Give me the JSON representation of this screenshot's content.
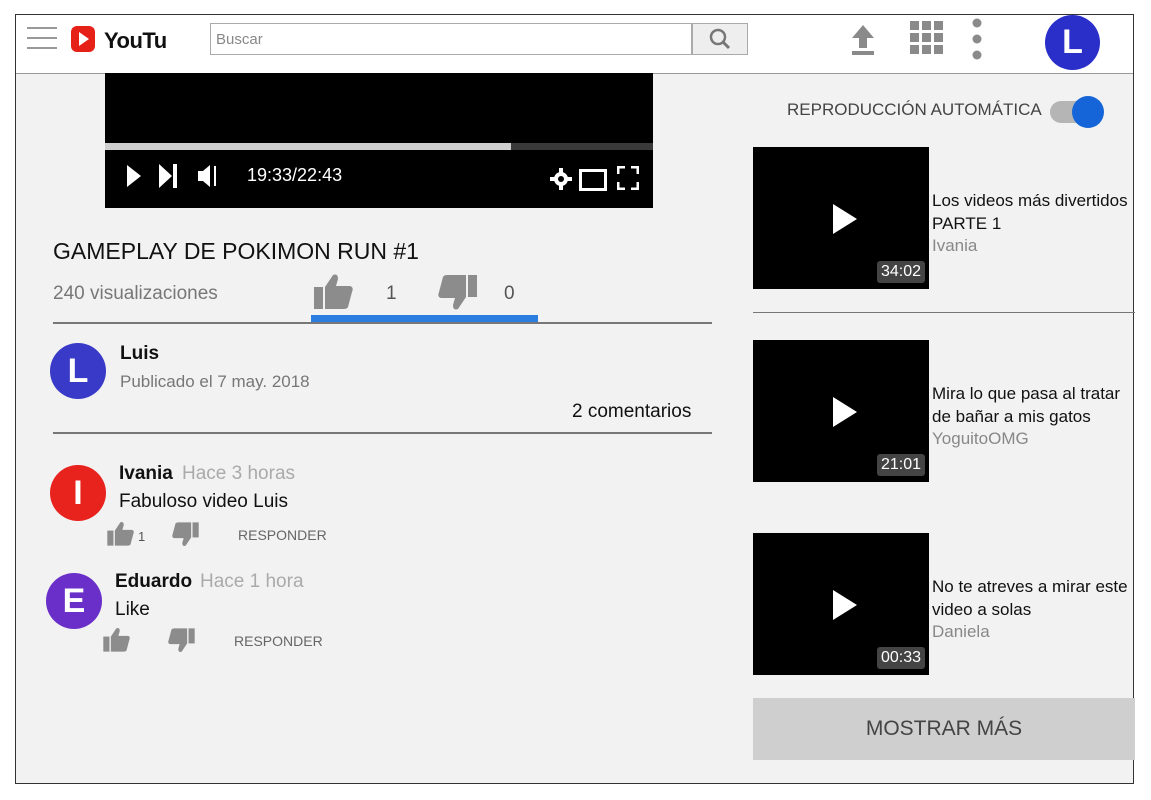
{
  "header": {
    "logo_text": "YouTu",
    "search_placeholder": "Buscar",
    "avatar_letter": "L",
    "colors": {
      "logo": "#e62117",
      "avatar": "#2a2fc9"
    }
  },
  "player": {
    "time": "19:33/22:43",
    "progress": 0.74
  },
  "video": {
    "title": "GAMEPLAY DE POKIMON RUN #1",
    "views": "240 visualizaciones",
    "likes": "1",
    "dislikes": "0",
    "like_ratio_color": "#2b7de0"
  },
  "uploader": {
    "initial": "L",
    "name": "Luis",
    "published": "Publicado el 7 may. 2018",
    "avatar_color": "#3a3ac8"
  },
  "comments_count": "2 comentarios",
  "comments": [
    {
      "initial": "I",
      "author": "Ivania",
      "time": "Hace 3 horas",
      "text": "Fabuloso video Luis",
      "likes": "1",
      "reply_label": "RESPONDER",
      "avatar_color": "#e8221d"
    },
    {
      "initial": "E",
      "author": "Eduardo",
      "time": "Hace 1 hora",
      "text": "Like",
      "likes": "",
      "reply_label": "RESPONDER",
      "avatar_color": "#6a2fc8"
    }
  ],
  "sidebar": {
    "autoplay_label": "REPRODUCCIÓN AUTOMÁTICA",
    "autoplay_on": true,
    "videos": [
      {
        "title_line1": "Los videos más divertidos",
        "title_line2": "PARTE 1",
        "channel": "Ivania",
        "duration": "34:02"
      },
      {
        "title_line1": "Mira lo que pasa al tratar",
        "title_line2": "de bañar a mis gatos",
        "channel": "YoguitoOMG",
        "duration": "21:01"
      },
      {
        "title_line1": "No te atreves a mirar este",
        "title_line2": "video a solas",
        "channel": "Daniela",
        "duration": "00:33"
      }
    ],
    "show_more_label": "MOSTRAR MÁS"
  }
}
